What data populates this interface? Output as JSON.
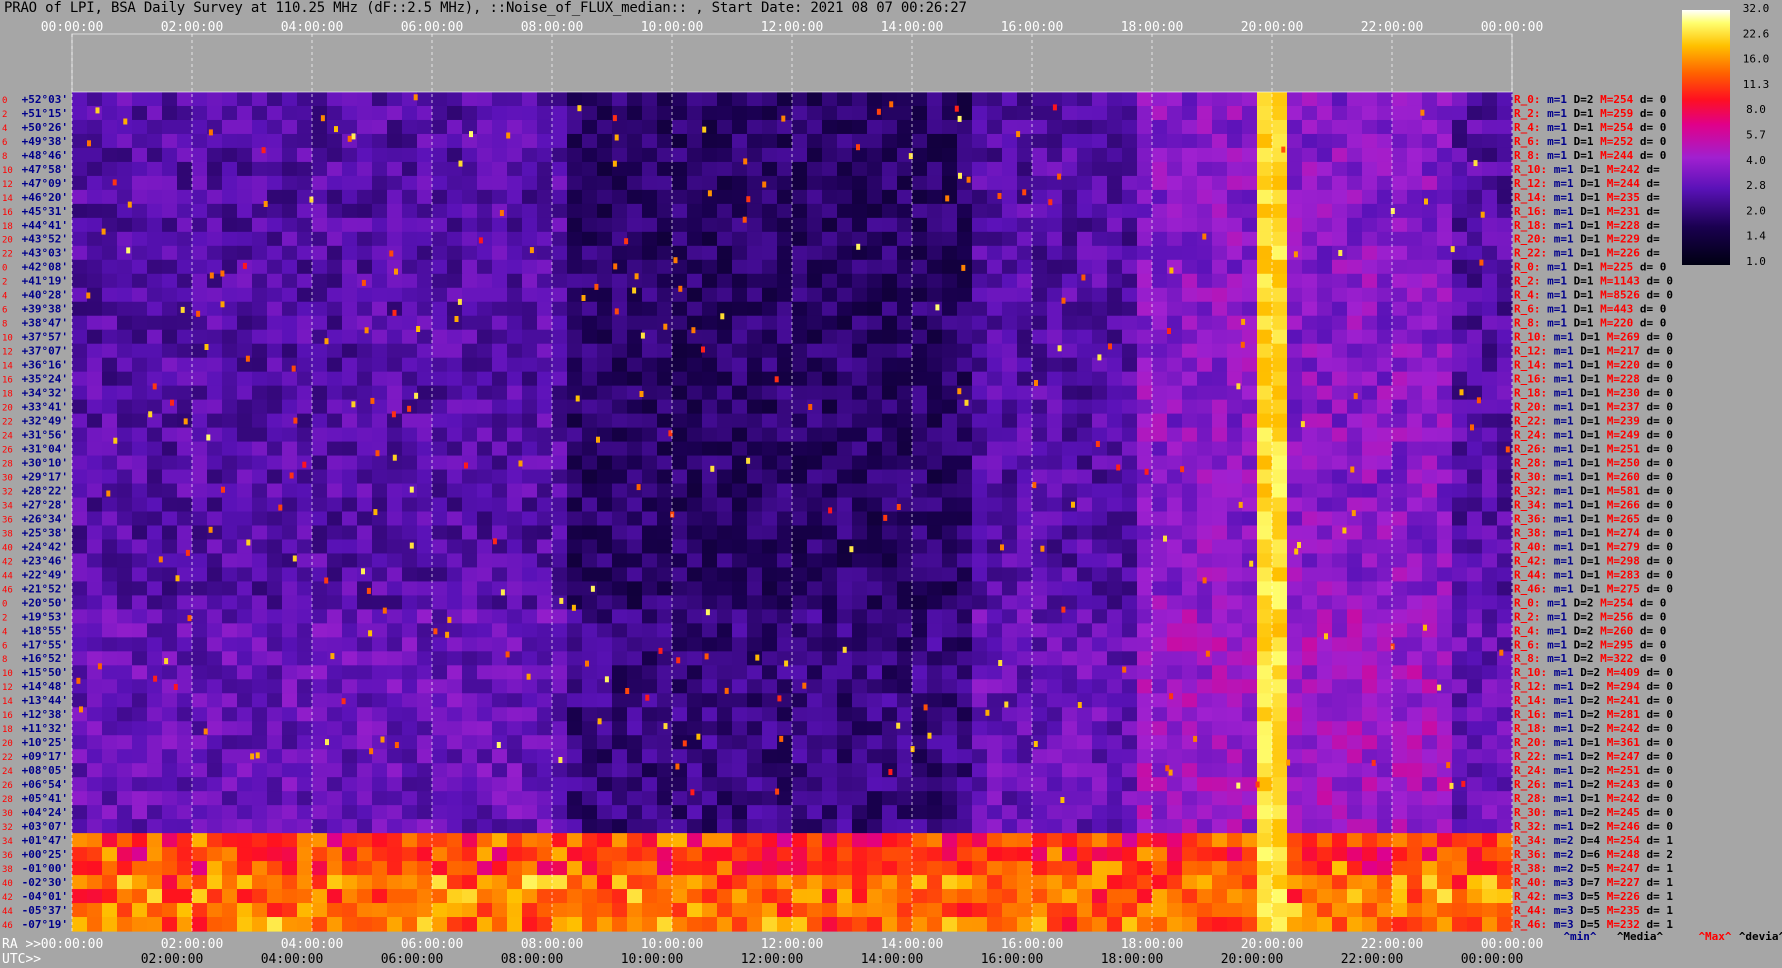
{
  "title": "PRAO of LPI, BSA Daily Survey at 110.25 MHz (dF::2.5 MHz), ::Noise_of_FLUX_median:: , Start Date: 2021 08 07 00:26:27",
  "chart_data": {
    "type": "heatmap",
    "title": "PRAO of LPI, BSA Daily Survey at 110.25 MHz (dF::2.5 MHz), ::Noise_of_FLUX_median:: , Start Date: 2021 08 07 00:26:27",
    "top_time_ticks": [
      "00:00:00",
      "02:00:00",
      "04:00:00",
      "06:00:00",
      "08:00:00",
      "10:00:00",
      "12:00:00",
      "14:00:00",
      "16:00:00",
      "18:00:00",
      "20:00:00",
      "22:00:00",
      "00:00:00"
    ],
    "ra_label": "RA >>",
    "ra_ticks": [
      "00:00:00",
      "02:00:00",
      "04:00:00",
      "06:00:00",
      "08:00:00",
      "10:00:00",
      "12:00:00",
      "14:00:00",
      "16:00:00",
      "18:00:00",
      "20:00:00",
      "22:00:00",
      "00:00:00"
    ],
    "utc_label": "UTC>>",
    "utc_ticks": [
      "02:00:00",
      "04:00:00",
      "06:00:00",
      "08:00:00",
      "10:00:00",
      "12:00:00",
      "14:00:00",
      "16:00:00",
      "18:00:00",
      "20:00:00",
      "22:00:00",
      "00:00:00"
    ],
    "dec_labels": [
      "+52°03'",
      "+51°15'",
      "+50°26'",
      "+49°38'",
      "+48°46'",
      "+47°58'",
      "+47°09'",
      "+46°20'",
      "+45°31'",
      "+44°41'",
      "+43°52'",
      "+43°03'",
      "+42°08'",
      "+41°19'",
      "+40°28'",
      "+39°38'",
      "+38°47'",
      "+37°57'",
      "+37°07'",
      "+36°16'",
      "+35°24'",
      "+34°32'",
      "+33°41'",
      "+32°49'",
      "+31°56'",
      "+31°04'",
      "+30°10'",
      "+29°17'",
      "+28°22'",
      "+27°28'",
      "+26°34'",
      "+25°38'",
      "+24°42'",
      "+23°46'",
      "+22°49'",
      "+21°52'",
      "+20°50'",
      "+19°53'",
      "+18°55'",
      "+17°55'",
      "+16°52'",
      "+15°50'",
      "+14°48'",
      "+13°44'",
      "+12°38'",
      "+11°32'",
      "+10°25'",
      "+09°17'",
      "+08°05'",
      "+06°54'",
      "+05°41'",
      "+04°24'",
      "+03°07'",
      "+01°47'",
      "+00°25'",
      "-01°00'",
      "-02°30'",
      "-04°01'",
      "-05°37'",
      "-07°19'"
    ],
    "row_index_labels": [
      "0",
      "2",
      "4",
      "6",
      "8",
      "10",
      "12",
      "14",
      "16",
      "18",
      "20",
      "22",
      "0",
      "2",
      "4",
      "6",
      "8",
      "10",
      "12",
      "14",
      "16",
      "18",
      "20",
      "22",
      "24",
      "26",
      "28",
      "30",
      "32",
      "34",
      "36",
      "38",
      "40",
      "42",
      "44",
      "46",
      "0",
      "2",
      "4",
      "6",
      "8",
      "10",
      "12",
      "14",
      "16",
      "18",
      "20",
      "22",
      "24",
      "26",
      "28",
      "30",
      "32",
      "34",
      "36",
      "38",
      "40",
      "42",
      "44",
      "46"
    ],
    "row_stats": [
      {
        "r": "R_0:",
        "m": "m=1",
        "d": "D=2",
        "mx": "M=254",
        "dv": "d= 0"
      },
      {
        "r": "R_2:",
        "m": "m=1",
        "d": "D=1",
        "mx": "M=259",
        "dv": "d= 0"
      },
      {
        "r": "R_4:",
        "m": "m=1",
        "d": "D=1",
        "mx": "M=254",
        "dv": "d= 0"
      },
      {
        "r": "R_6:",
        "m": "m=1",
        "d": "D=1",
        "mx": "M=252",
        "dv": "d= 0"
      },
      {
        "r": "R_8:",
        "m": "m=1",
        "d": "D=1",
        "mx": "M=244",
        "dv": "d= 0"
      },
      {
        "r": "R_10:",
        "m": "m=1",
        "d": "D=1",
        "mx": "M=242",
        "dv": "d="
      },
      {
        "r": "R_12:",
        "m": "m=1",
        "d": "D=1",
        "mx": "M=244",
        "dv": "d="
      },
      {
        "r": "R_14:",
        "m": "m=1",
        "d": "D=1",
        "mx": "M=235",
        "dv": "d="
      },
      {
        "r": "R_16:",
        "m": "m=1",
        "d": "D=1",
        "mx": "M=231",
        "dv": "d="
      },
      {
        "r": "R_18:",
        "m": "m=1",
        "d": "D=1",
        "mx": "M=228",
        "dv": "d="
      },
      {
        "r": "R_20:",
        "m": "m=1",
        "d": "D=1",
        "mx": "M=229",
        "dv": "d="
      },
      {
        "r": "R_22:",
        "m": "m=1",
        "d": "D=1",
        "mx": "M=226",
        "dv": "d="
      },
      {
        "r": "R_0:",
        "m": "m=1",
        "d": "D=1",
        "mx": "M=225",
        "dv": "d= 0"
      },
      {
        "r": "R_2:",
        "m": "m=1",
        "d": "D=1",
        "mx": "M=1143",
        "dv": "d= 0"
      },
      {
        "r": "R_4:",
        "m": "m=1",
        "d": "D=1",
        "mx": "M=8526",
        "dv": "d= 0"
      },
      {
        "r": "R_6:",
        "m": "m=1",
        "d": "D=1",
        "mx": "M=443",
        "dv": "d= 0"
      },
      {
        "r": "R_8:",
        "m": "m=1",
        "d": "D=1",
        "mx": "M=220",
        "dv": "d= 0"
      },
      {
        "r": "R_10:",
        "m": "m=1",
        "d": "D=1",
        "mx": "M=269",
        "dv": "d= 0"
      },
      {
        "r": "R_12:",
        "m": "m=1",
        "d": "D=1",
        "mx": "M=217",
        "dv": "d= 0"
      },
      {
        "r": "R_14:",
        "m": "m=1",
        "d": "D=1",
        "mx": "M=220",
        "dv": "d= 0"
      },
      {
        "r": "R_16:",
        "m": "m=1",
        "d": "D=1",
        "mx": "M=228",
        "dv": "d= 0"
      },
      {
        "r": "R_18:",
        "m": "m=1",
        "d": "D=1",
        "mx": "M=230",
        "dv": "d= 0"
      },
      {
        "r": "R_20:",
        "m": "m=1",
        "d": "D=1",
        "mx": "M=237",
        "dv": "d= 0"
      },
      {
        "r": "R_22:",
        "m": "m=1",
        "d": "D=1",
        "mx": "M=239",
        "dv": "d= 0"
      },
      {
        "r": "R_24:",
        "m": "m=1",
        "d": "D=1",
        "mx": "M=249",
        "dv": "d= 0"
      },
      {
        "r": "R_26:",
        "m": "m=1",
        "d": "D=1",
        "mx": "M=251",
        "dv": "d= 0"
      },
      {
        "r": "R_28:",
        "m": "m=1",
        "d": "D=1",
        "mx": "M=250",
        "dv": "d= 0"
      },
      {
        "r": "R_30:",
        "m": "m=1",
        "d": "D=1",
        "mx": "M=260",
        "dv": "d= 0"
      },
      {
        "r": "R_32:",
        "m": "m=1",
        "d": "D=1",
        "mx": "M=581",
        "dv": "d= 0"
      },
      {
        "r": "R_34:",
        "m": "m=1",
        "d": "D=1",
        "mx": "M=266",
        "dv": "d= 0"
      },
      {
        "r": "R_36:",
        "m": "m=1",
        "d": "D=1",
        "mx": "M=265",
        "dv": "d= 0"
      },
      {
        "r": "R_38:",
        "m": "m=1",
        "d": "D=1",
        "mx": "M=274",
        "dv": "d= 0"
      },
      {
        "r": "R_40:",
        "m": "m=1",
        "d": "D=1",
        "mx": "M=279",
        "dv": "d= 0"
      },
      {
        "r": "R_42:",
        "m": "m=1",
        "d": "D=1",
        "mx": "M=298",
        "dv": "d= 0"
      },
      {
        "r": "R_44:",
        "m": "m=1",
        "d": "D=1",
        "mx": "M=283",
        "dv": "d= 0"
      },
      {
        "r": "R_46:",
        "m": "m=1",
        "d": "D=1",
        "mx": "M=275",
        "dv": "d= 0"
      },
      {
        "r": "R_0:",
        "m": "m=1",
        "d": "D=2",
        "mx": "M=254",
        "dv": "d= 0"
      },
      {
        "r": "R_2:",
        "m": "m=1",
        "d": "D=2",
        "mx": "M=256",
        "dv": "d= 0"
      },
      {
        "r": "R_4:",
        "m": "m=1",
        "d": "D=2",
        "mx": "M=260",
        "dv": "d= 0"
      },
      {
        "r": "R_6:",
        "m": "m=1",
        "d": "D=2",
        "mx": "M=295",
        "dv": "d= 0"
      },
      {
        "r": "R_8:",
        "m": "m=1",
        "d": "D=2",
        "mx": "M=322",
        "dv": "d= 0"
      },
      {
        "r": "R_10:",
        "m": "m=1",
        "d": "D=2",
        "mx": "M=409",
        "dv": "d= 0"
      },
      {
        "r": "R_12:",
        "m": "m=1",
        "d": "D=2",
        "mx": "M=294",
        "dv": "d= 0"
      },
      {
        "r": "R_14:",
        "m": "m=1",
        "d": "D=2",
        "mx": "M=241",
        "dv": "d= 0"
      },
      {
        "r": "R_16:",
        "m": "m=1",
        "d": "D=2",
        "mx": "M=281",
        "dv": "d= 0"
      },
      {
        "r": "R_18:",
        "m": "m=1",
        "d": "D=2",
        "mx": "M=242",
        "dv": "d= 0"
      },
      {
        "r": "R_20:",
        "m": "m=1",
        "d": "D=1",
        "mx": "M=361",
        "dv": "d= 0"
      },
      {
        "r": "R_22:",
        "m": "m=1",
        "d": "D=2",
        "mx": "M=247",
        "dv": "d= 0"
      },
      {
        "r": "R_24:",
        "m": "m=1",
        "d": "D=2",
        "mx": "M=251",
        "dv": "d= 0"
      },
      {
        "r": "R_26:",
        "m": "m=1",
        "d": "D=2",
        "mx": "M=243",
        "dv": "d= 0"
      },
      {
        "r": "R_28:",
        "m": "m=1",
        "d": "D=1",
        "mx": "M=242",
        "dv": "d= 0"
      },
      {
        "r": "R_30:",
        "m": "m=1",
        "d": "D=2",
        "mx": "M=245",
        "dv": "d= 0"
      },
      {
        "r": "R_32:",
        "m": "m=1",
        "d": "D=2",
        "mx": "M=246",
        "dv": "d= 0"
      },
      {
        "r": "R_34:",
        "m": "m=2",
        "d": "D=4",
        "mx": "M=254",
        "dv": "d= 1"
      },
      {
        "r": "R_36:",
        "m": "m=2",
        "d": "D=6",
        "mx": "M=248",
        "dv": "d= 2"
      },
      {
        "r": "R_38:",
        "m": "m=2",
        "d": "D=5",
        "mx": "M=247",
        "dv": "d= 1"
      },
      {
        "r": "R_40:",
        "m": "m=3",
        "d": "D=7",
        "mx": "M=227",
        "dv": "d= 1"
      },
      {
        "r": "R_42:",
        "m": "m=3",
        "d": "D=5",
        "mx": "M=226",
        "dv": "d= 1"
      },
      {
        "r": "R_44:",
        "m": "m=3",
        "d": "D=5",
        "mx": "M=235",
        "dv": "d= 1"
      },
      {
        "r": "R_46:",
        "m": "m=3",
        "d": "D=5",
        "mx": "M=232",
        "dv": "d= 1"
      }
    ],
    "footer_labels": [
      "^min^",
      "^Media^",
      "^Max^",
      "^devia^"
    ],
    "colorbar_ticks": [
      "32.0",
      "22.6",
      "16.0",
      "11.3",
      "8.0",
      "5.7",
      "4.0",
      "2.8",
      "2.0",
      "1.4",
      "1.0"
    ],
    "colors": {
      "background": "#a6a6a6",
      "label_red": "#ff0000",
      "label_blue": "#00008b",
      "grid": "#ffffff"
    }
  }
}
